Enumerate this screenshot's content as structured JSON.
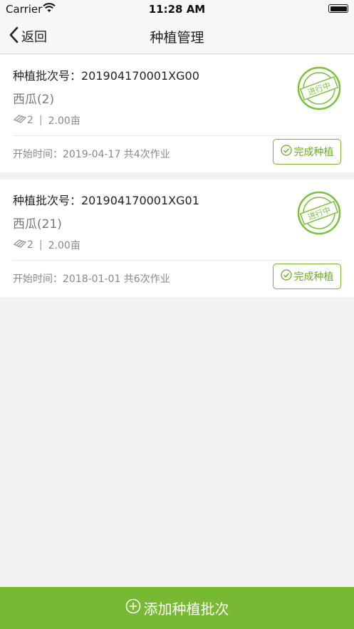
{
  "status_bar": {
    "carrier": "Carrier",
    "time": "11:28 AM"
  },
  "nav": {
    "back_label": "返回",
    "title": "种植管理"
  },
  "batches": [
    {
      "batch_label": "种植批次号：201904170001XG00",
      "crop": "西瓜(2)",
      "count": "2",
      "area": "2.00亩",
      "start_info": "开始时间：2019-04-17 共4次作业",
      "status_stamp": "进行中",
      "complete_label": "完成种植"
    },
    {
      "batch_label": "种植批次号：201904170001XG01",
      "crop": "西瓜(21)",
      "count": "2",
      "area": "2.00亩",
      "start_info": "开始时间：2018-01-01 共6次作业",
      "status_stamp": "进行中",
      "complete_label": "完成种植"
    }
  ],
  "add_button_label": "添加种植批次",
  "colors": {
    "accent": "#77b933",
    "stamp": "#7cc13a"
  }
}
